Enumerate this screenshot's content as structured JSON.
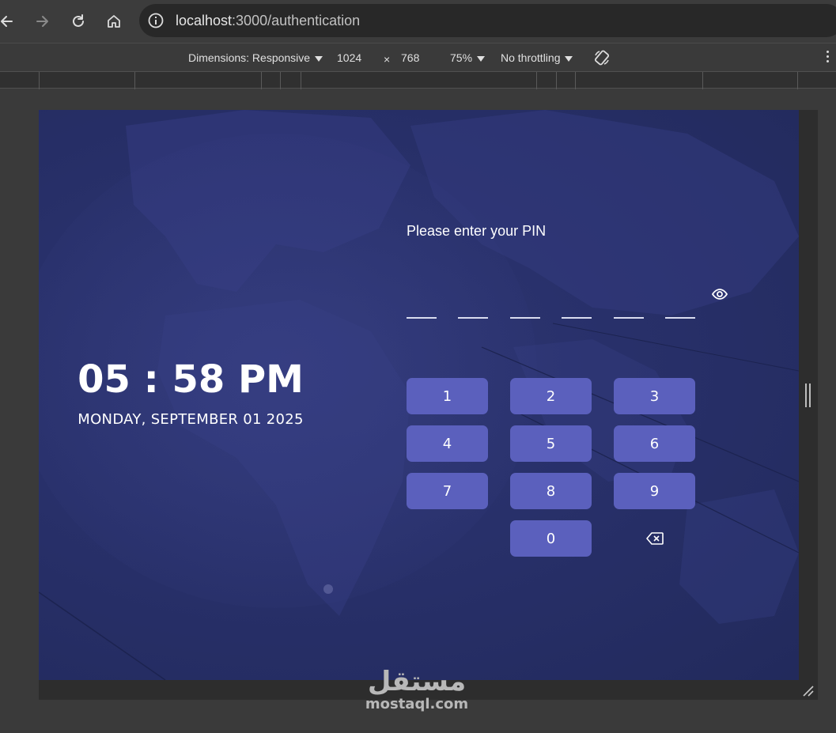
{
  "browser": {
    "url_host": "localhost",
    "url_path": ":3000/authentication",
    "icons": [
      "back-arrow-icon",
      "forward-arrow-icon",
      "reload-icon",
      "home-icon",
      "site-info-icon"
    ]
  },
  "devtools": {
    "dimensions_label": "Dimensions: Responsive",
    "width": "1024",
    "times": "×",
    "height": "768",
    "zoom": "75%",
    "throttling": "No throttling",
    "icons": [
      "rotate-icon",
      "more-options-icon"
    ]
  },
  "app": {
    "clock": "05 : 58 PM",
    "date": "MONDAY, SEPTEMBER 01 2025",
    "prompt": "Please enter your PIN",
    "pin_length": 6,
    "keys": [
      "1",
      "2",
      "3",
      "4",
      "5",
      "6",
      "7",
      "8",
      "9",
      "0"
    ],
    "icons": [
      "eye-icon",
      "backspace-icon"
    ],
    "colors": {
      "background": "#28306a",
      "key": "#5b60bd",
      "text": "#ffffff"
    }
  },
  "watermark": {
    "arabic": "مستقل",
    "latin": "mostaql.com"
  }
}
